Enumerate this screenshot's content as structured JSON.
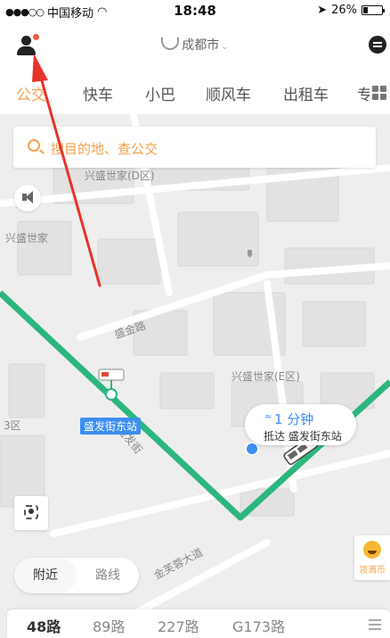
{
  "status_bar": {
    "carrier": "中国移动",
    "time": "18:48",
    "battery": "26%",
    "battery_level": 0.26
  },
  "header": {
    "city": "成都市"
  },
  "tabs": [
    {
      "label": "公交",
      "active": true
    },
    {
      "label": "快车",
      "active": false
    },
    {
      "label": "小巴",
      "active": false
    },
    {
      "label": "顺风车",
      "active": false
    },
    {
      "label": "出租车",
      "active": false
    },
    {
      "label": "专",
      "active": false
    }
  ],
  "search": {
    "placeholder": "搜目的地、查公交"
  },
  "map": {
    "labels": {
      "xingsheng_d": "兴盛世家(D区)",
      "xingsheng_left": "兴盛世家",
      "xingsheng_e": "兴盛世家(E区)",
      "shengjin_road": "盛金路",
      "shengfa_street": "盛发街",
      "jinfurong": "金芙蓉大道",
      "fragment_left": "3区"
    },
    "stop_name": "盛发街东站",
    "route_color": "#2cb67d",
    "accent": "#f5a04f",
    "eta": {
      "main": "1 分钟",
      "sub": "抵达 盛发街东站"
    },
    "side_badge": "领滴币"
  },
  "bottom": {
    "toggle": {
      "nearby": "附近",
      "route": "路线"
    },
    "routes": [
      "48路",
      "89路",
      "227路",
      "G173路"
    ]
  }
}
